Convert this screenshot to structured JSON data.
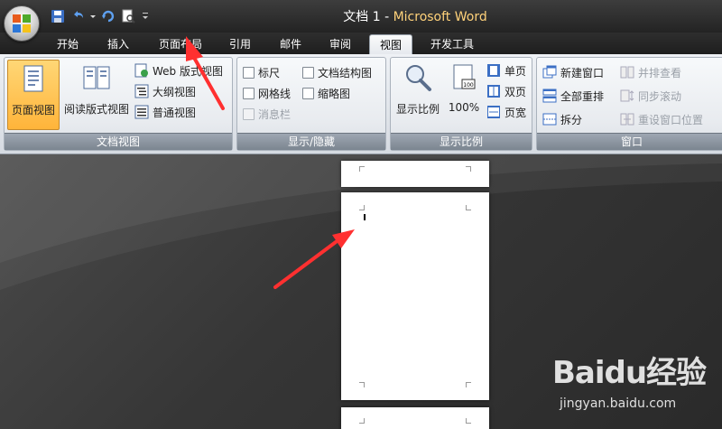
{
  "window": {
    "title_prefix": "文档 1 - ",
    "title_app": "Microsoft Word"
  },
  "quick_access": {
    "icons": [
      "save-icon",
      "undo-icon",
      "dropdown-icon",
      "redo-icon",
      "print-preview-icon",
      "customize-icon"
    ]
  },
  "tabs": [
    {
      "label": "开始"
    },
    {
      "label": "插入"
    },
    {
      "label": "页面布局"
    },
    {
      "label": "引用"
    },
    {
      "label": "邮件"
    },
    {
      "label": "审阅"
    },
    {
      "label": "视图",
      "active": true
    },
    {
      "label": "开发工具"
    }
  ],
  "ribbon": {
    "doc_views": {
      "label": "文档视图",
      "print_layout": "页面视图",
      "full_screen_reading": "阅读版式视图",
      "web_layout": "Web 版式视图",
      "outline": "大纲视图",
      "draft": "普通视图"
    },
    "show_hide": {
      "label": "显示/隐藏",
      "ruler": "标尺",
      "gridlines": "网格线",
      "message_bar": "消息栏",
      "document_map": "文档结构图",
      "thumbnails": "缩略图"
    },
    "zoom": {
      "label": "显示比例",
      "zoom_button": "显示比例",
      "percent_100": "100%",
      "one_page": "单页",
      "two_pages": "双页",
      "page_width": "页宽"
    },
    "window": {
      "label": "窗口",
      "new_window": "新建窗口",
      "arrange_all": "全部重排",
      "split": "拆分",
      "side_by_side": "并排查看",
      "sync_scroll": "同步滚动",
      "reset_position": "重设窗口位置"
    }
  },
  "watermark": {
    "brand": "Baidu经验",
    "site": "jingyan.baidu.com"
  }
}
